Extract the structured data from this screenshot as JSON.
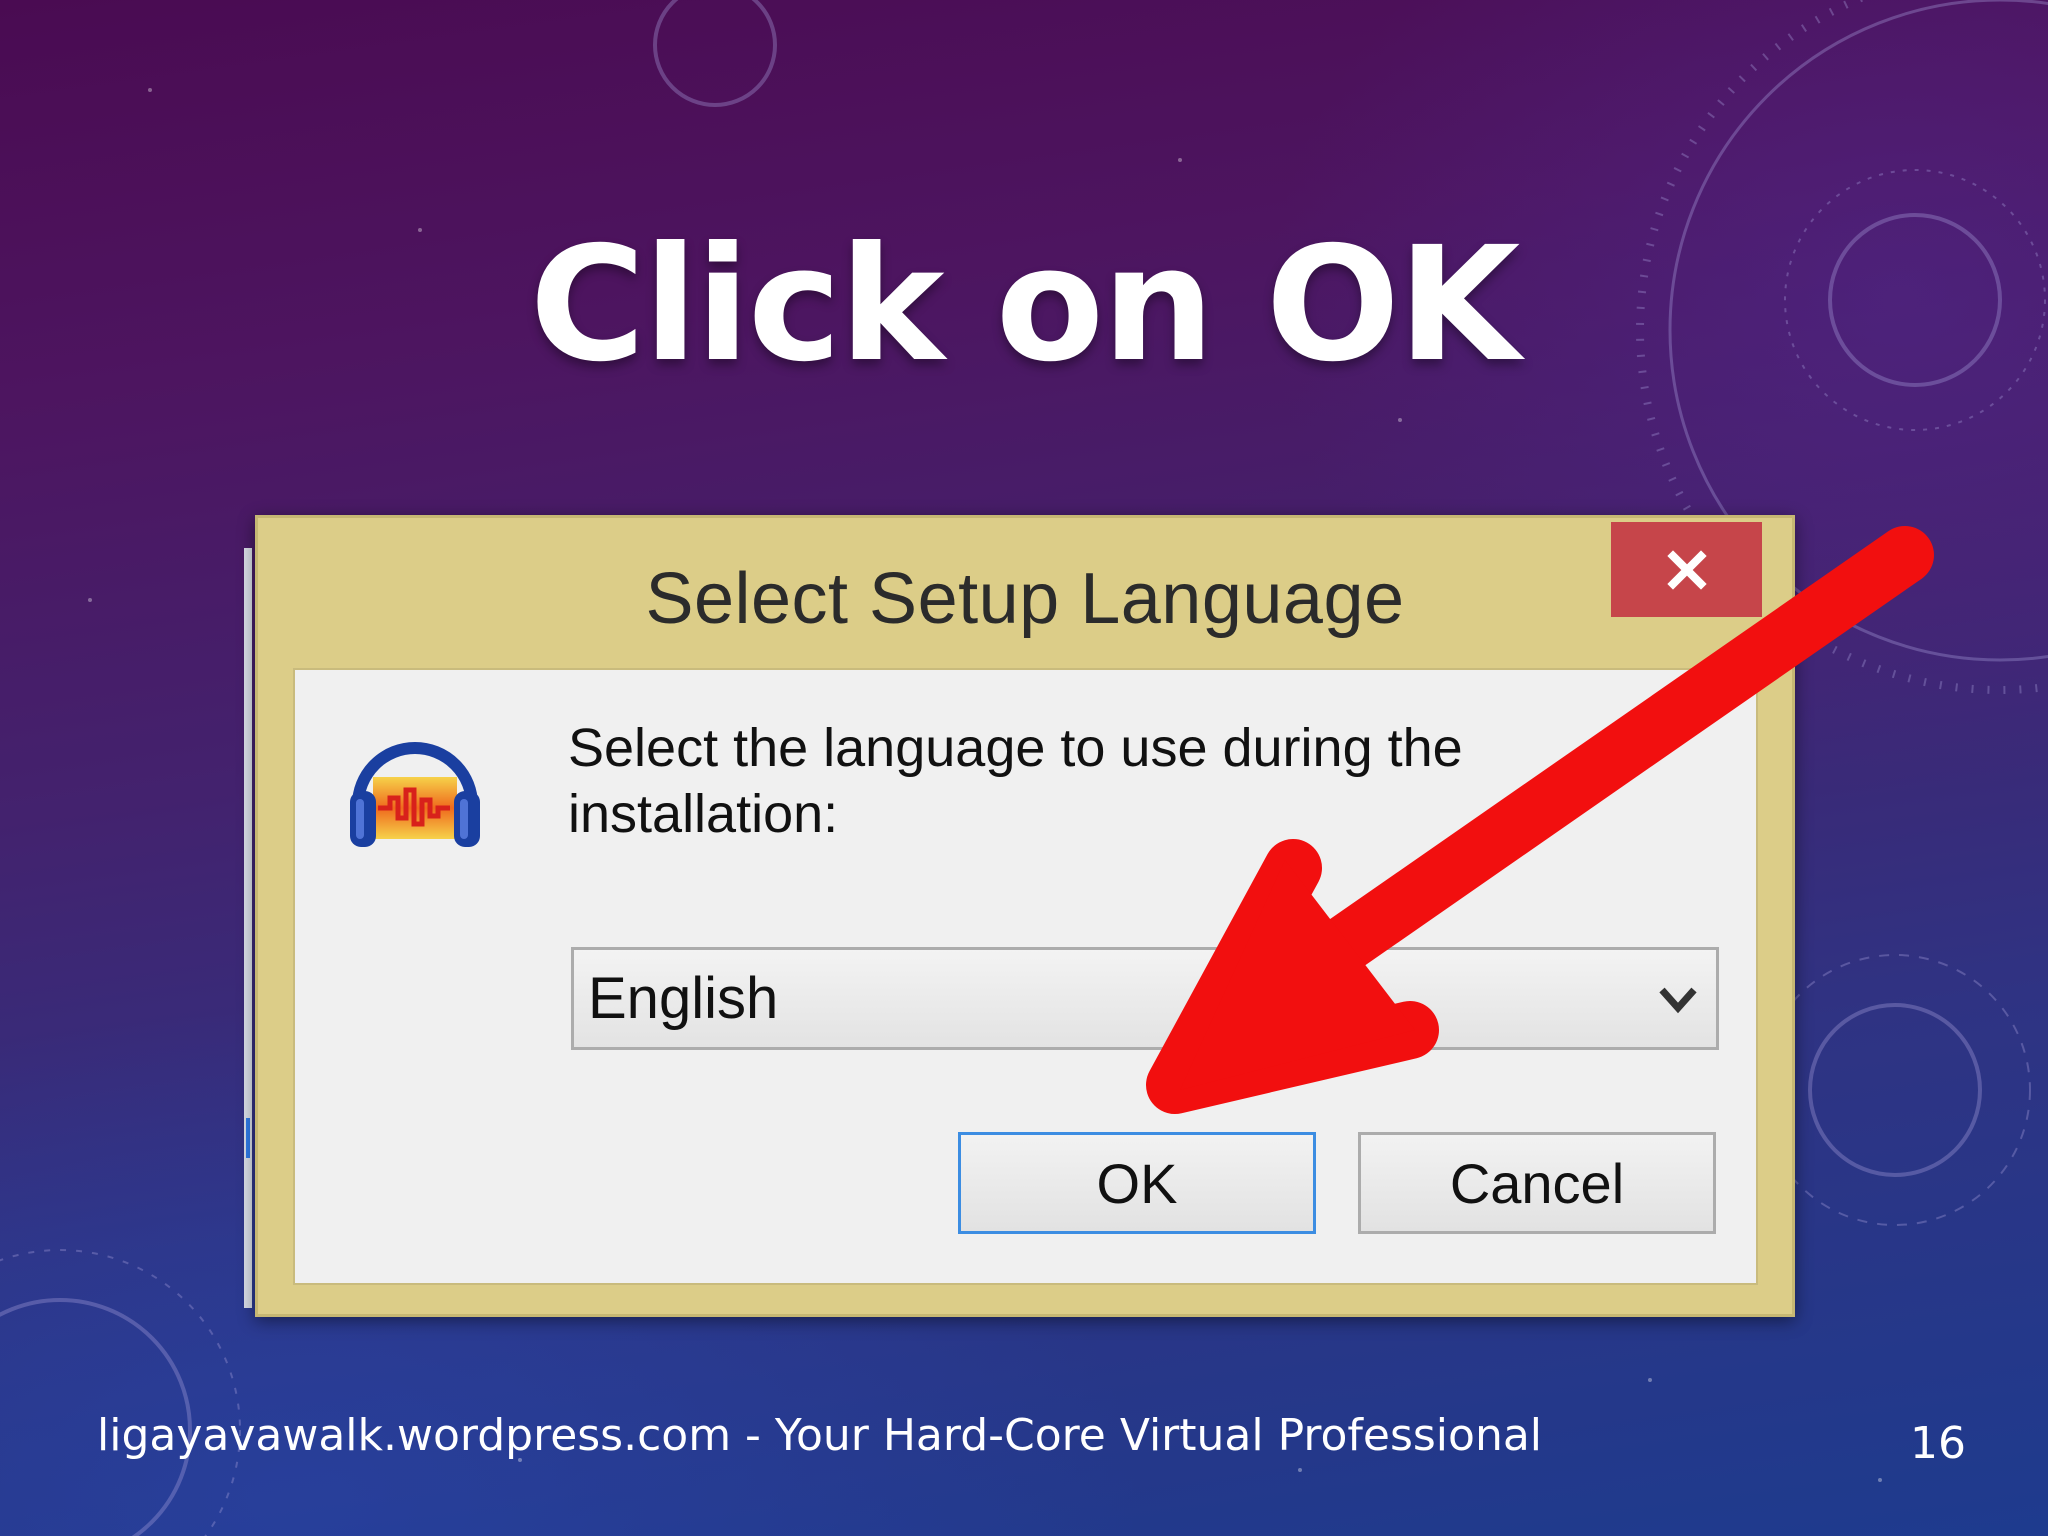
{
  "slide": {
    "title": "Click on OK",
    "footer": "ligayavawalk.wordpress.com - Your Hard-Core Virtual Professional",
    "page_number": "16"
  },
  "dialog": {
    "title": "Select Setup Language",
    "close_icon": "close-icon",
    "app_icon": "audacity-headphones-icon",
    "prompt": "Select the language to use during the installation:",
    "language": {
      "selected": "English",
      "dropdown_icon": "chevron-down-icon"
    },
    "buttons": {
      "ok_label": "OK",
      "cancel_label": "Cancel"
    }
  },
  "annotation": {
    "arrow_color": "#f20f0f",
    "arrow_icon": "red-arrow-pointer"
  },
  "colors": {
    "window_frame": "#dccd88",
    "close_button": "#c6454a",
    "ok_focus_border": "#3c8de2"
  }
}
